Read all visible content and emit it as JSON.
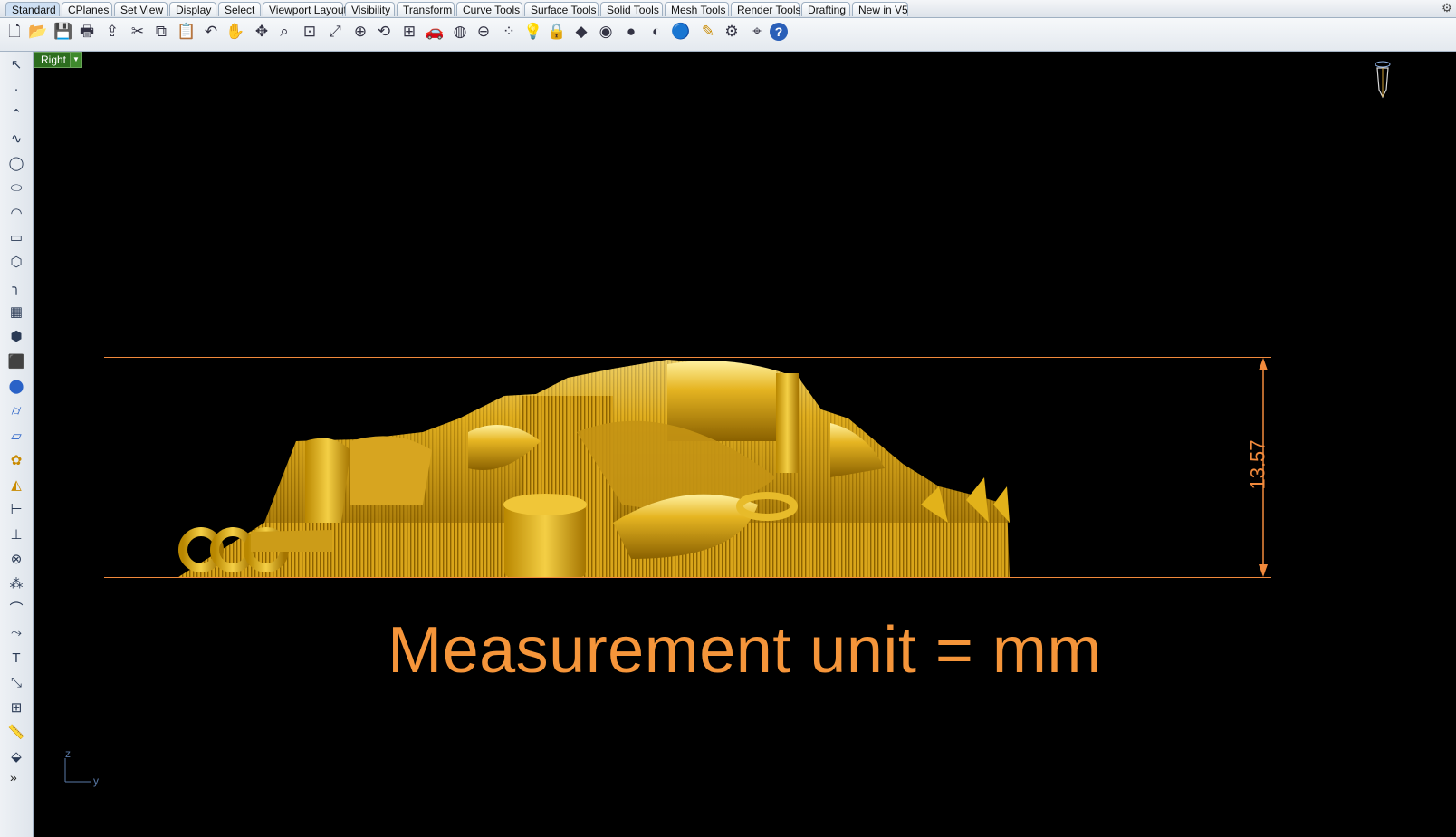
{
  "tabs": [
    {
      "label": "Standard",
      "active": true
    },
    {
      "label": "CPlanes"
    },
    {
      "label": "Set View"
    },
    {
      "label": "Display"
    },
    {
      "label": "Select"
    },
    {
      "label": "Viewport Layout"
    },
    {
      "label": "Visibility"
    },
    {
      "label": "Transform"
    },
    {
      "label": "Curve Tools"
    },
    {
      "label": "Surface Tools"
    },
    {
      "label": "Solid Tools"
    },
    {
      "label": "Mesh Tools"
    },
    {
      "label": "Render Tools"
    },
    {
      "label": "Drafting"
    },
    {
      "label": "New in V5"
    }
  ],
  "toolbar_icons": [
    "new-document-icon",
    "open-folder-icon",
    "save-icon",
    "print-icon",
    "import-icon",
    "cut-icon",
    "copy-icon",
    "paste-icon",
    "undo-icon",
    "pan-hand-icon",
    "rotate-view-icon",
    "zoom-dynamic-icon",
    "zoom-window-icon",
    "zoom-extents-icon",
    "zoom-selected-icon",
    "rotate-view-2-icon",
    "viewport-grid-icon",
    "car-icon",
    "hide-objects-icon",
    "lock-toggle-icon",
    "select-points-icon",
    "lightbulb-icon",
    "lock-icon",
    "layers-icon",
    "color-wheel-icon",
    "shaded-sphere-icon",
    "rendered-sphere-icon",
    "blue-sphere-icon",
    "pencil-icon",
    "gear-icon",
    "dimension-icon",
    "help-icon"
  ],
  "sidebar_icons": [
    "select-arrow-icon",
    "point-icon",
    "polyline-icon",
    "curve-icon",
    "circle-icon",
    "ellipse-icon",
    "arc-icon",
    "rectangle-icon",
    "polygon-icon",
    "fillet-curve-icon",
    "surface-icon",
    "extrude-icon",
    "box-icon",
    "solid-union-icon",
    "cylinder-icon",
    "patch-icon",
    "gear-solid-icon",
    "analyze-icon",
    "dimension-tool-icon",
    "split-icon",
    "boolean-icon",
    "array-icon",
    "blend-curve-icon",
    "offset-curve-icon",
    "text-icon",
    "transform-icon",
    "group-icon",
    "ruler-icon",
    "cube-icon"
  ],
  "viewport": {
    "name": "Right",
    "dimension_value": "13.57",
    "caption": "Measurement unit = mm",
    "axis_z": "z",
    "axis_y": "y"
  },
  "colors": {
    "dimension": "#f28a3c",
    "caption": "#f5953a",
    "gold": "#e2b21a"
  }
}
